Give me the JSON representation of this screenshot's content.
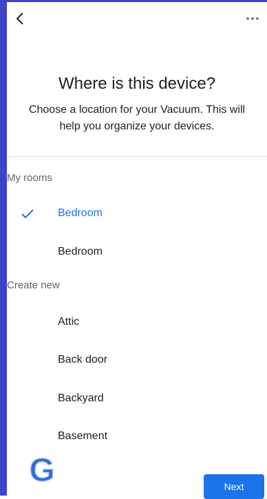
{
  "header": {
    "back_icon": "chevron-left-icon",
    "more_icon": "more-horizontal-icon"
  },
  "title": "Where is this device?",
  "subtitle": "Choose a location for your Vacuum. This will help you organize your devices.",
  "my_rooms": {
    "heading": "My rooms",
    "items": [
      {
        "label": "Bedroom",
        "selected": true
      },
      {
        "label": "Bedroom",
        "selected": false
      }
    ]
  },
  "create_new": {
    "heading": "Create new",
    "items": [
      {
        "label": "Attic"
      },
      {
        "label": "Back door"
      },
      {
        "label": "Backyard"
      },
      {
        "label": "Basement"
      }
    ]
  },
  "footer": {
    "logo_icon": "g-logo-icon",
    "next_label": "Next"
  },
  "colors": {
    "accent": "#1a73e8",
    "frame_border": "#3d44c9",
    "text_primary": "#202124",
    "text_secondary": "#5f6368"
  }
}
